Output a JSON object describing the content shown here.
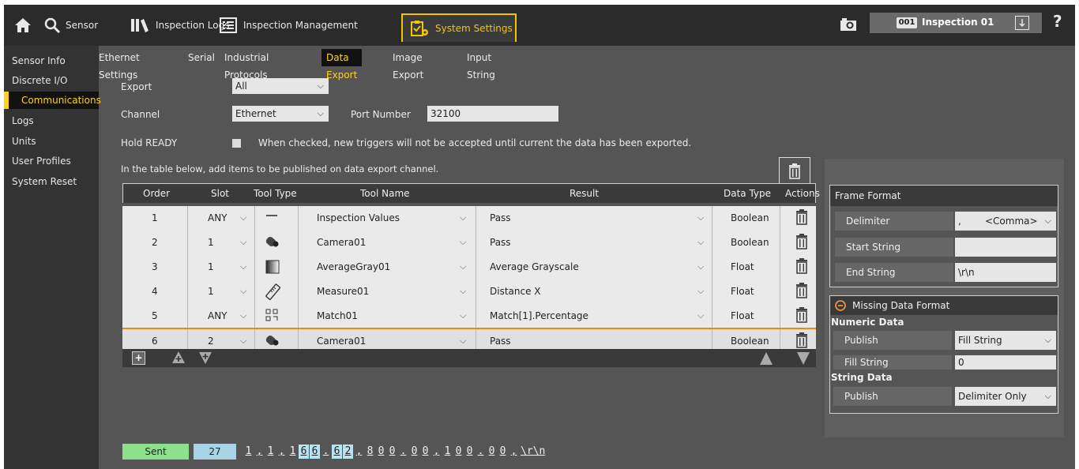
{
  "topbar": {
    "sensor_label": "Sensor",
    "logs_label": "Inspection Logs",
    "mgmt_label": "Inspection Management",
    "settings_label": "System Settings",
    "inspection_number": "001",
    "inspection_name": "Inspection 01",
    "help_label": "?"
  },
  "sidebar": {
    "items": [
      {
        "label": "Sensor Info"
      },
      {
        "label": "Discrete I/O"
      },
      {
        "label": "Communications"
      },
      {
        "label": "Logs"
      },
      {
        "label": "Units"
      },
      {
        "label": "User Profiles"
      },
      {
        "label": "System Reset"
      }
    ]
  },
  "subtabs": [
    "Ethernet Settings",
    "Serial",
    "Industrial Protocols",
    "Data Export",
    "Image Export",
    "Input String"
  ],
  "form": {
    "export_label": "Export",
    "export_value": "All",
    "channel_label": "Channel",
    "channel_value": "Ethernet",
    "port_label": "Port Number",
    "port_value": "32100",
    "hold_label": "Hold READY",
    "hold_description": "When checked, new triggers will not be accepted until current the data has been exported.",
    "table_instruction": "In the table below, add items to be published on data export channel."
  },
  "table": {
    "headers": [
      "Order",
      "Slot",
      "Tool Type",
      "Tool Name",
      "Result",
      "Data Type",
      "Actions"
    ],
    "rows": [
      {
        "order": "1",
        "slot": "ANY",
        "tool_icon": "dash-icon",
        "tool_name": "Inspection Values",
        "result": "Pass",
        "data_type": "Boolean"
      },
      {
        "order": "2",
        "slot": "1",
        "tool_icon": "camera-tool-icon",
        "tool_name": "Camera01",
        "result": "Pass",
        "data_type": "Boolean"
      },
      {
        "order": "3",
        "slot": "1",
        "tool_icon": "gradient-tool-icon",
        "tool_name": "AverageGray01",
        "result": "Average Grayscale",
        "data_type": "Float"
      },
      {
        "order": "4",
        "slot": "1",
        "tool_icon": "ruler-tool-icon",
        "tool_name": "Measure01",
        "result": "Distance X",
        "data_type": "Float"
      },
      {
        "order": "5",
        "slot": "ANY",
        "tool_icon": "match-tool-icon",
        "tool_name": "Match01",
        "result": "Match[1].Percentage",
        "data_type": "Float"
      },
      {
        "order": "6",
        "slot": "2",
        "tool_icon": "camera-tool-icon",
        "tool_name": "Camera01",
        "result": "Pass",
        "data_type": "Boolean"
      }
    ]
  },
  "frame_format": {
    "title": "Frame Format",
    "delimiter_label": "Delimiter",
    "delimiter_char": ",",
    "delimiter_value": "<Comma>",
    "start_label": "Start String",
    "start_value": "",
    "end_label": "End String",
    "end_value": "\\r\\n"
  },
  "missing_format": {
    "title": "Missing Data Format",
    "numeric_label": "Numeric Data",
    "publish_label": "Publish",
    "numeric_publish_value": "Fill String",
    "fill_label": "Fill String",
    "fill_value": "0",
    "string_label": "String Data",
    "string_publish_label": "Publish",
    "string_publish_value": "Delimiter Only"
  },
  "status": {
    "sent_label": "Sent",
    "count": "27",
    "chars": [
      "1",
      ",",
      "1",
      ",",
      "1",
      "6",
      "6",
      ".",
      "6",
      "2",
      ",",
      "8",
      "0",
      "0",
      ".",
      "0",
      "0",
      ",",
      "1",
      "0",
      "0",
      ".",
      "0",
      "0",
      ",",
      "\\r\\n"
    ],
    "highlight": [
      5,
      6,
      8,
      9
    ]
  },
  "colors": {
    "accent": "#f5c400",
    "sent": "#8ee08e",
    "count": "#a8d4e6",
    "selected_border": "#e68a1a"
  }
}
